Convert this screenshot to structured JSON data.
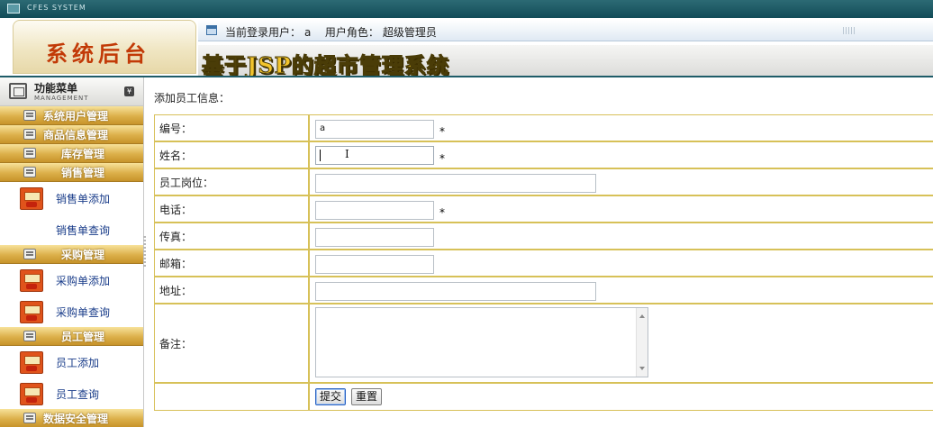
{
  "titlebar": {
    "system_name": "CFES SYSTEM"
  },
  "header": {
    "brand": "系统后台",
    "user_label": "当前登录用户：",
    "user_value": "a",
    "role_label": "用户角色：",
    "role_value": "超级管理员",
    "app_title": "基于JSP的超市管理系统"
  },
  "sidebar": {
    "title": "功能菜单",
    "subtitle": "MANAGEMENT",
    "collapse_glyph": "¥",
    "menu": [
      {
        "label": "系统用户管理",
        "items": []
      },
      {
        "label": "商品信息管理",
        "items": []
      },
      {
        "label": "库存管理",
        "items": []
      },
      {
        "label": "销售管理",
        "items": [
          "销售单添加",
          "销售单查询"
        ]
      },
      {
        "label": "采购管理",
        "items": [
          "采购单添加",
          "采购单查询"
        ]
      },
      {
        "label": "员工管理",
        "items": [
          "员工添加",
          "员工查询"
        ]
      },
      {
        "label": "数据安全管理",
        "items": []
      }
    ]
  },
  "form": {
    "title": "添加员工信息：",
    "fields": [
      {
        "label": "编号：",
        "value": "a",
        "required": true
      },
      {
        "label": "姓名：",
        "value": "",
        "required": true
      },
      {
        "label": "员工岗位：",
        "value": ""
      },
      {
        "label": "电话：",
        "value": "",
        "required": true
      },
      {
        "label": "传真：",
        "value": ""
      },
      {
        "label": "邮箱：",
        "value": ""
      },
      {
        "label": "地址：",
        "value": ""
      },
      {
        "label": "备注：",
        "value": ""
      }
    ],
    "required_mark": "*",
    "submit_label": "提交",
    "reset_label": "重置",
    "cursor_glyph": "I"
  }
}
